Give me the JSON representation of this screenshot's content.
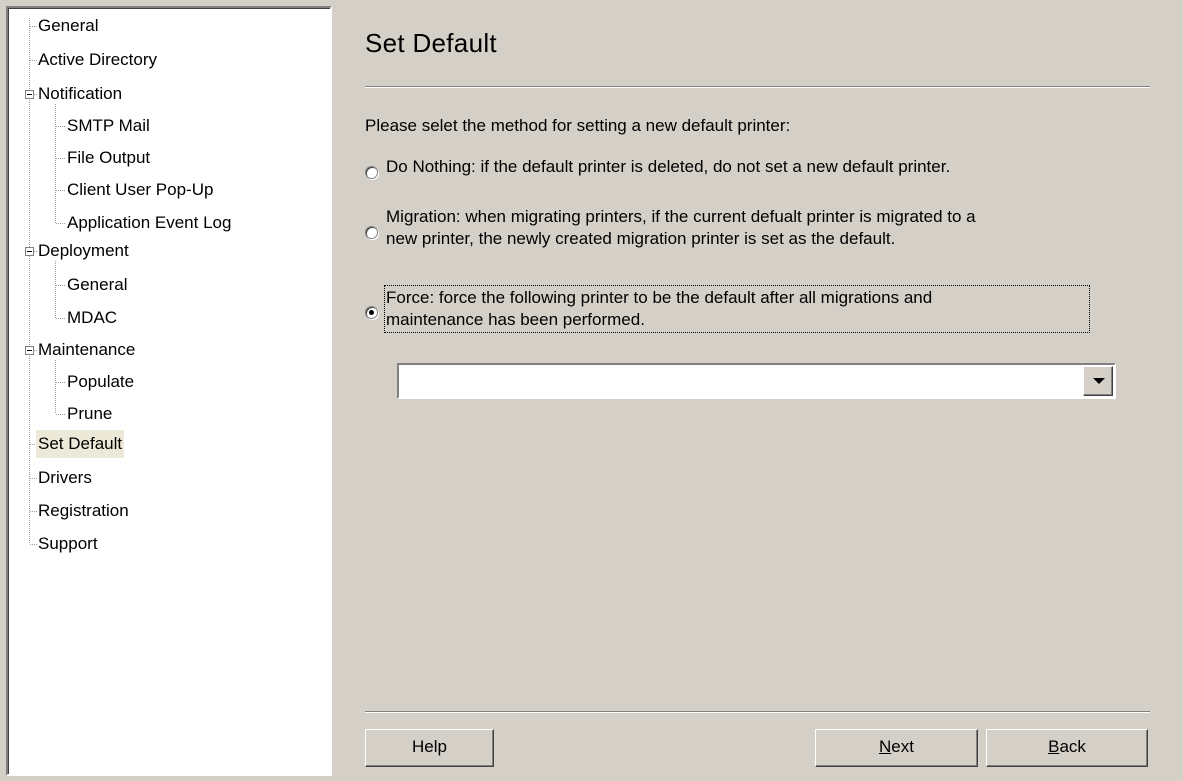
{
  "tree": {
    "items": [
      {
        "label": "General"
      },
      {
        "label": "Active Directory"
      },
      {
        "label": "Notification"
      },
      {
        "label": "SMTP Mail"
      },
      {
        "label": "File Output"
      },
      {
        "label": "Client User Pop-Up"
      },
      {
        "label": "Application Event Log"
      },
      {
        "label": "Deployment"
      },
      {
        "label": "General"
      },
      {
        "label": "MDAC"
      },
      {
        "label": "Maintenance"
      },
      {
        "label": "Populate"
      },
      {
        "label": "Prune"
      },
      {
        "label": "Set Default"
      },
      {
        "label": "Drivers"
      },
      {
        "label": "Registration"
      },
      {
        "label": "Support"
      }
    ],
    "selected_label": "Set Default"
  },
  "page": {
    "title": "Set Default",
    "prompt": "Please selet the method for setting a new default printer:",
    "options": [
      {
        "line1": "Do Nothing: if the default printer is deleted, do not set a new default printer.",
        "line2": "",
        "checked": false
      },
      {
        "line1": "Migration: when migrating printers, if the current defualt printer is migrated to a",
        "line2": "new printer, the newly created migration printer is set as the default.",
        "checked": false
      },
      {
        "line1": "Force: force the following printer to be the default after all migrations and",
        "line2": "maintenance has been performed.",
        "checked": true
      }
    ],
    "printer_select": {
      "value": ""
    }
  },
  "buttons": {
    "help": "Help",
    "next_mnemonic": "N",
    "next_rest": "ext",
    "back_mnemonic": "B",
    "back_rest": "ack"
  }
}
